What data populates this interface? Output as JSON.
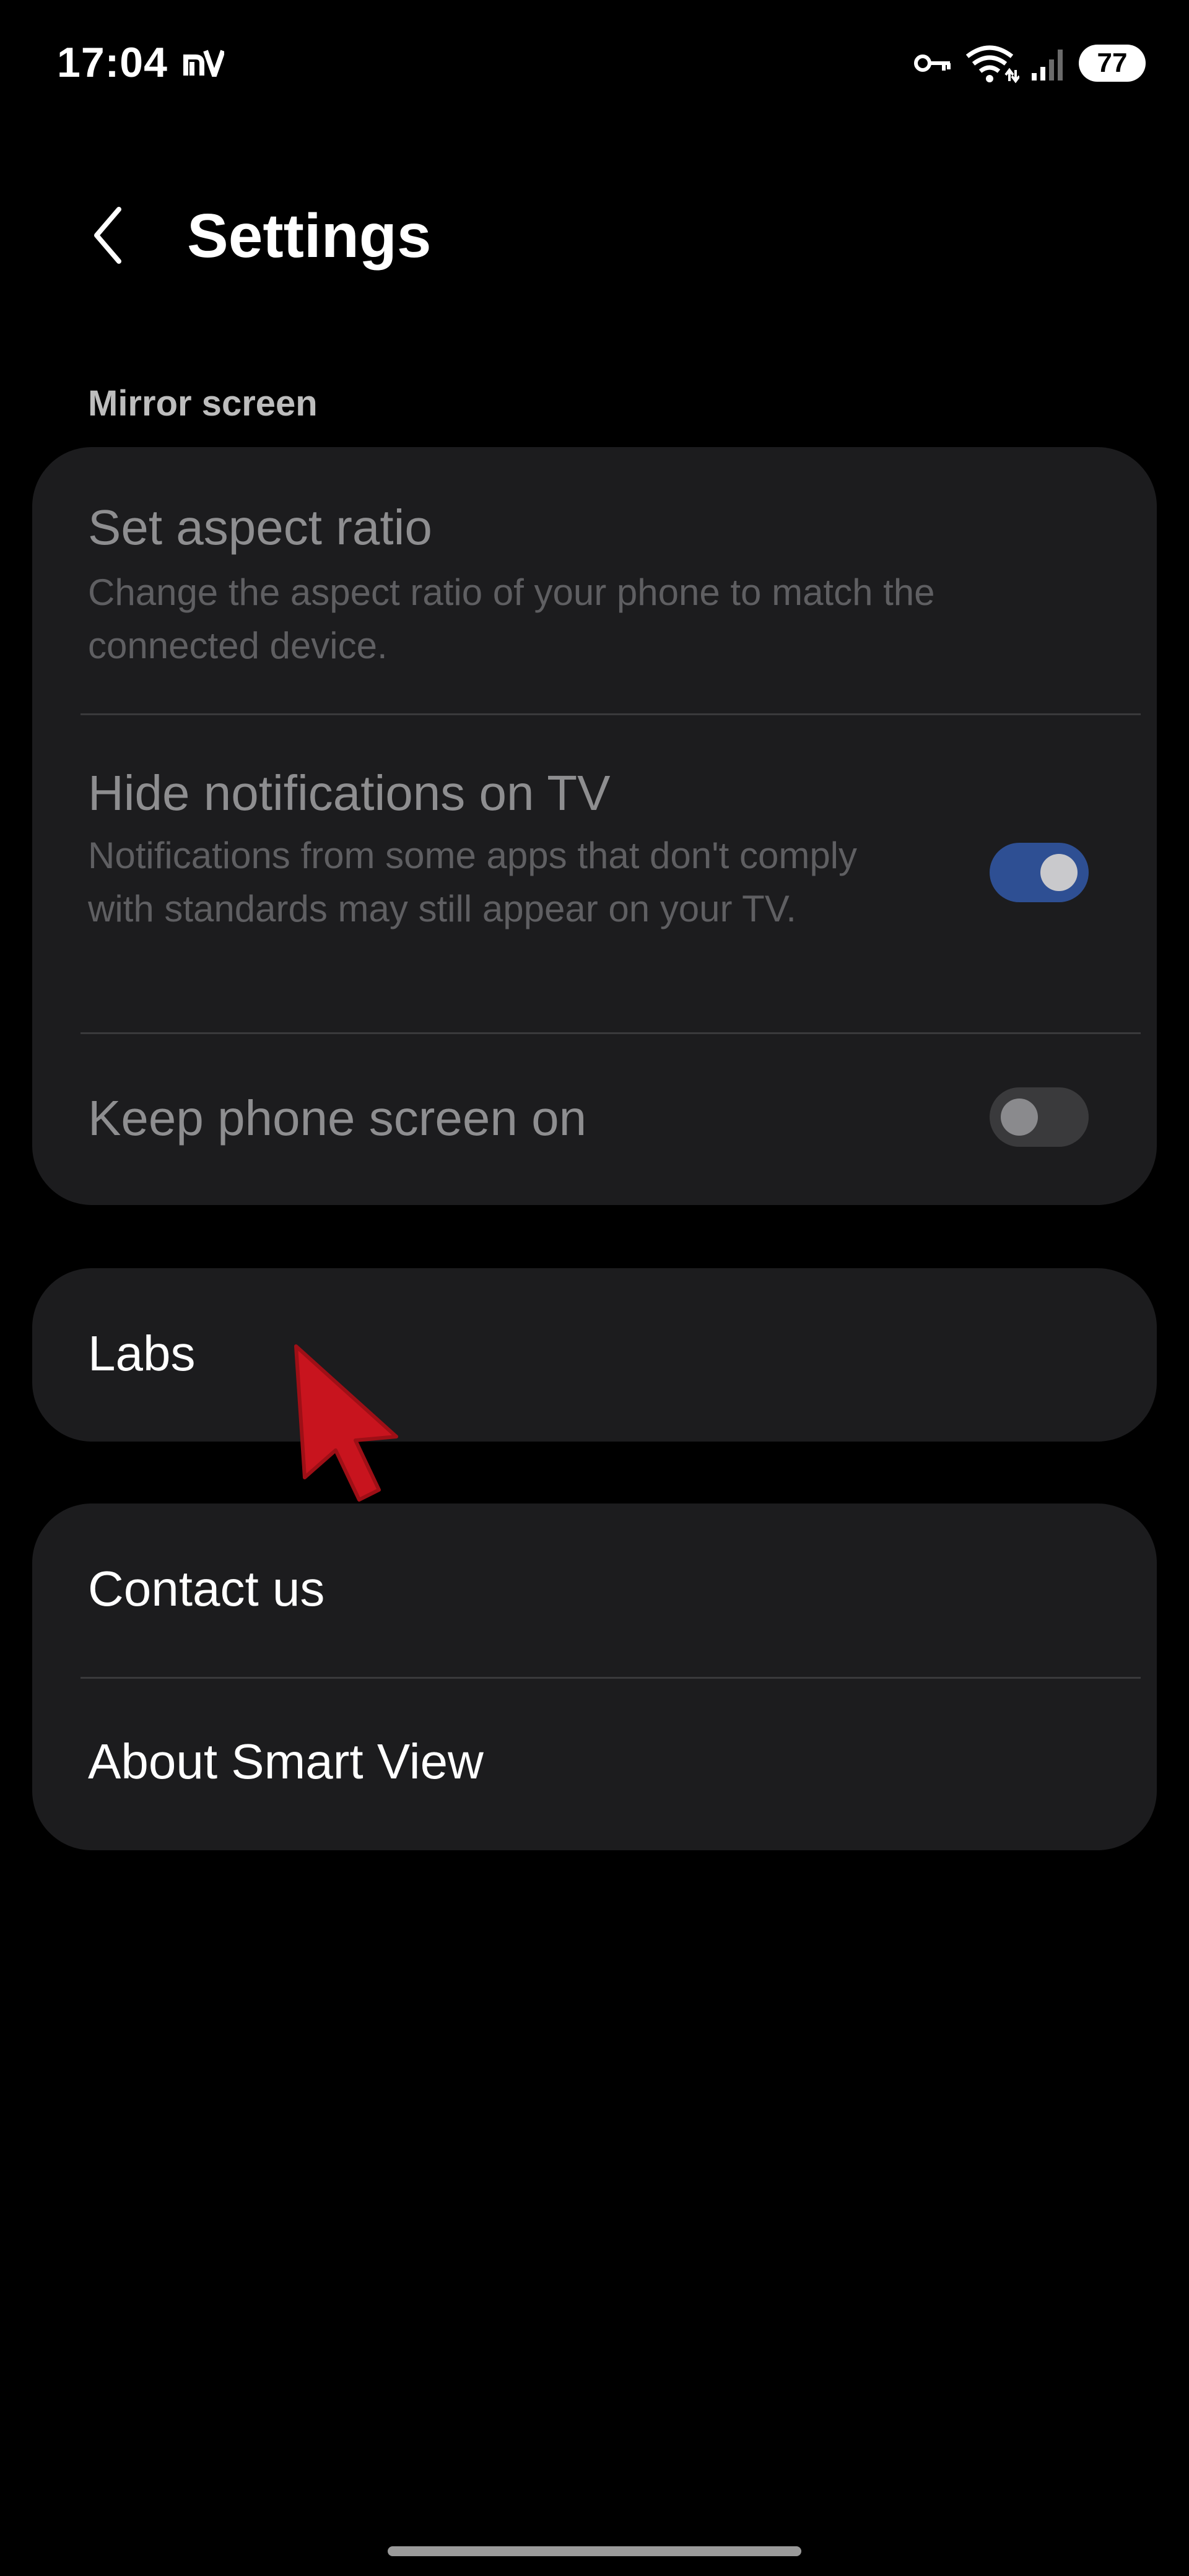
{
  "status_bar": {
    "time": "17:04",
    "battery": "77",
    "icons": [
      "carrier-icon",
      "vpn-key-icon",
      "wifi-icon",
      "signal-icon",
      "battery-icon"
    ]
  },
  "header": {
    "back_icon": "chevron-left-icon",
    "title": "Settings"
  },
  "mirror_section": {
    "header": "Mirror screen",
    "aspect_ratio": {
      "title": "Set aspect ratio",
      "description": "Change the aspect ratio of your phone to match the connected device."
    },
    "hide_notifications": {
      "title": "Hide notifications on TV",
      "description": "Notifications from some apps that don't comply with standards may still appear on your TV.",
      "enabled": true
    },
    "keep_screen_on": {
      "title": "Keep phone screen on",
      "enabled": false
    }
  },
  "labs": {
    "title": "Labs"
  },
  "about_section": {
    "contact_us": "Contact us",
    "about_smart_view": "About Smart View"
  },
  "colors": {
    "background": "#000000",
    "card": "#1c1c1e",
    "toggle_on": "#2e4f93",
    "cursor": "#c8141e"
  }
}
